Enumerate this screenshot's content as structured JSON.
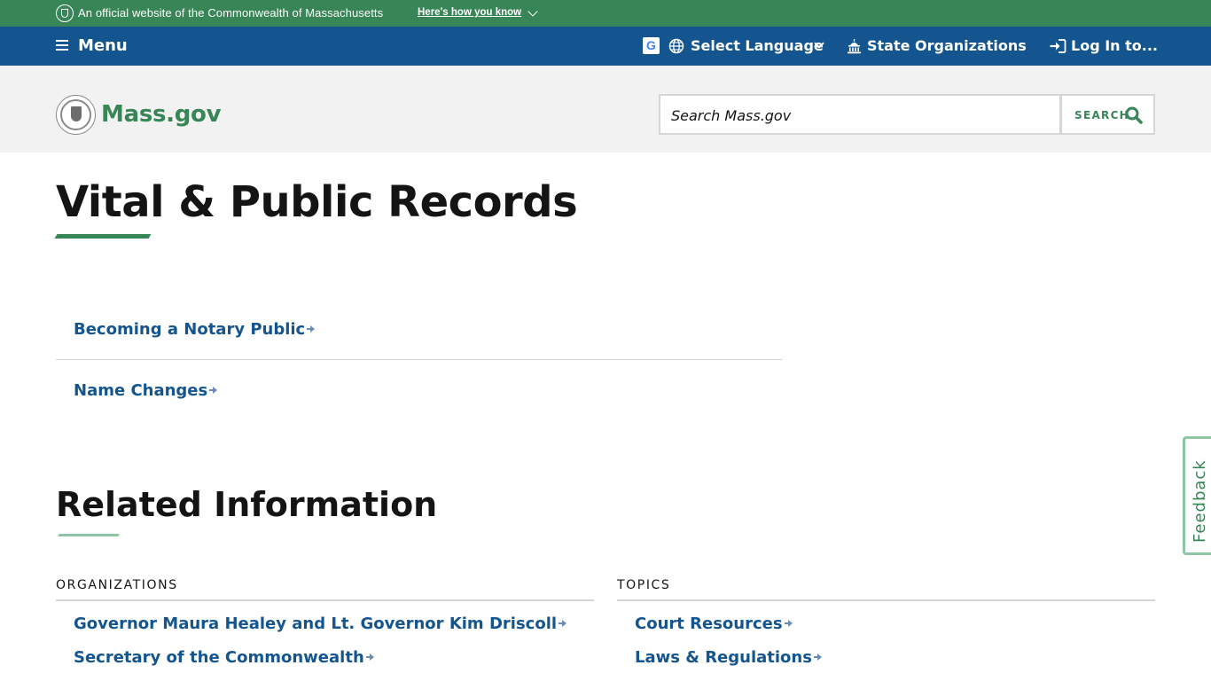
{
  "official_banner": {
    "text": "An official website of the Commonwealth of Massachusetts",
    "link": "Here's how you know"
  },
  "nav": {
    "menu_label": "Menu",
    "google_icon": "G",
    "language_label": "Select Language",
    "orgs_label": "State Organizations",
    "login_label": "Log In to..."
  },
  "header": {
    "logo_text": "Mass.gov",
    "search_placeholder": "Search Mass.gov",
    "search_button_label": "SEARCH"
  },
  "page": {
    "title": "Vital & Public Records",
    "links": [
      {
        "label": "Becoming a Notary Public"
      },
      {
        "label": "Name Changes"
      }
    ]
  },
  "related": {
    "title": "Related Information",
    "organizations": {
      "heading": "ORGANIZATIONS",
      "items": [
        {
          "label": "Governor Maura Healey and Lt. Governor Kim Driscoll"
        },
        {
          "label": "Secretary of the Commonwealth"
        }
      ]
    },
    "topics": {
      "heading": "TOPICS",
      "items": [
        {
          "label": "Court Resources"
        },
        {
          "label": "Laws & Regulations"
        }
      ]
    }
  },
  "feedback": {
    "label": "Feedback"
  },
  "colors": {
    "green": "#388557",
    "blue": "#14558f",
    "light_green": "#8ec5a5"
  }
}
